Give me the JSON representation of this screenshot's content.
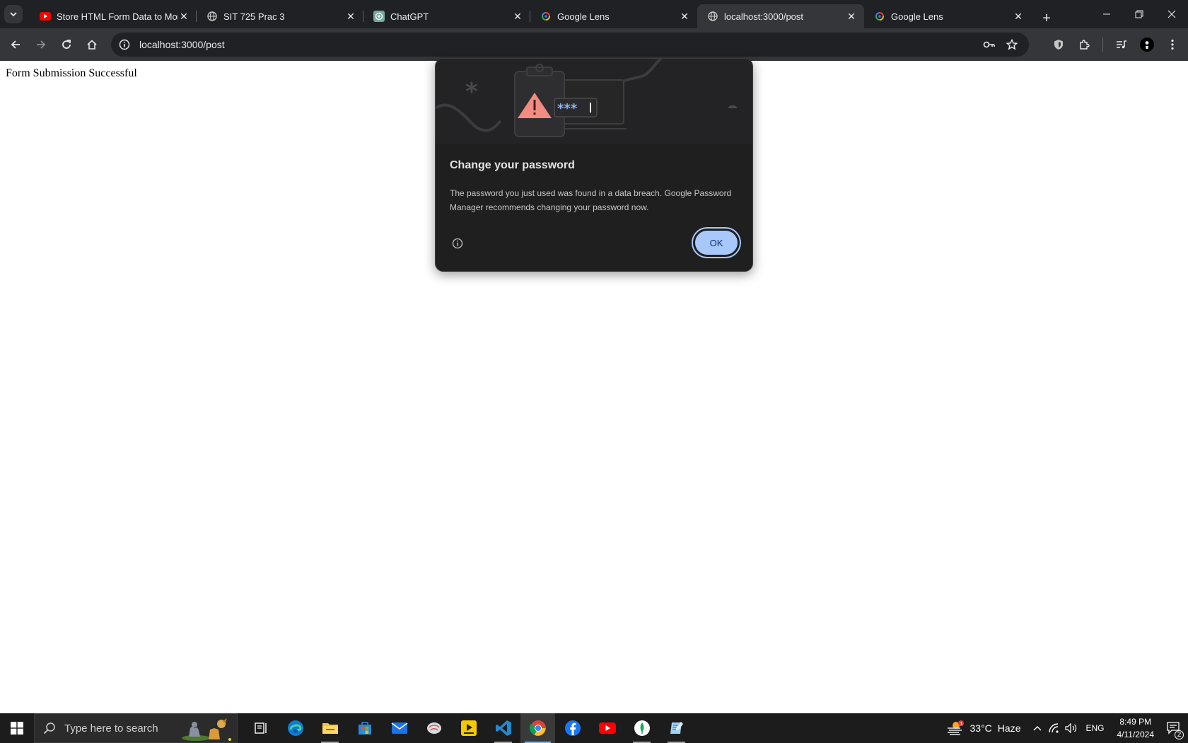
{
  "browser": {
    "tabs": [
      {
        "title": "Store HTML Form Data to MongoDB",
        "favicon": "youtube-icon",
        "active": false
      },
      {
        "title": "SIT 725 Prac 3",
        "favicon": "globe-icon",
        "active": false
      },
      {
        "title": "ChatGPT",
        "favicon": "chatgpt-icon",
        "active": false
      },
      {
        "title": "Google Lens",
        "favicon": "google-lens-icon",
        "active": false
      },
      {
        "title": "localhost:3000/post",
        "favicon": "globe-icon",
        "active": true
      },
      {
        "title": "Google Lens",
        "favicon": "google-lens-icon",
        "active": false
      }
    ],
    "url": "localhost:3000/post"
  },
  "page": {
    "text": "Form Submission Successful"
  },
  "dialog": {
    "title": "Change your password",
    "body": "The password you just used was found in a data breach. Google Password Manager recommends changing your password now.",
    "ok_label": "OK",
    "illustration_text": "***"
  },
  "taskbar": {
    "search_placeholder": "Type here to search",
    "weather_temp": "33°C",
    "weather_desc": "Haze",
    "weather_badge": "1",
    "language": "ENG",
    "time": "8:49 PM",
    "date": "4/11/2024",
    "notification_count": "2"
  },
  "colors": {
    "tabstrip_bg": "#202124",
    "toolbar_bg": "#35363a",
    "dialog_bg": "#1f1f1f",
    "dialog_button": "#a8c7fa",
    "taskbar_bg": "#1c1c1c"
  }
}
